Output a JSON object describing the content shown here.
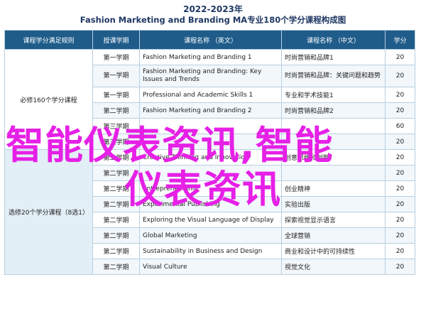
{
  "title": {
    "line1": "2022-2023年",
    "line2": "Fashion Marketing and Branding MA专业180个学分课程构成图"
  },
  "table": {
    "headers": [
      "课程学分满足规则",
      "授课学期",
      "课程名称 （英文）",
      "课程名称 （中文）",
      "学分"
    ],
    "groups": [
      {
        "label": "必修160个学分课程",
        "rows": [
          {
            "sem": "第一学期",
            "en": "Fashion Marketing and Branding 1",
            "zh": "时尚营销和品牌1",
            "cr": "20"
          },
          {
            "sem": "第一学期",
            "en": "Fashion Marketing and Branding: Key Issues and Trends",
            "zh": "时尚营销和品牌：关键问题和趋势",
            "cr": "20"
          },
          {
            "sem": "第一学期",
            "en": "Professional and Academic Skills 1",
            "zh": "专业和学术技能1",
            "cr": "20"
          },
          {
            "sem": "第二学期",
            "en": "Fashion Marketing and Branding 2",
            "zh": "时尚营销和品牌2",
            "cr": "20"
          },
          {
            "sem": "第三学期",
            "en": "",
            "zh": "",
            "cr": "60"
          },
          {
            "sem": "第三学期",
            "en": "",
            "zh": "",
            "cr": "20"
          }
        ]
      },
      {
        "label": "选修20个学分课程（8选1）",
        "rows": [
          {
            "sem": "第二学期",
            "en": "Creative Thinking and Innovation",
            "zh": "创意思维和创新",
            "cr": "20"
          },
          {
            "sem": "第二学期",
            "en": "",
            "zh": "",
            "cr": "20"
          },
          {
            "sem": "第二学期",
            "en": "Entrepreneurship",
            "zh": "创业精神",
            "cr": "20"
          },
          {
            "sem": "第二学期",
            "en": "Experimental Publishing",
            "zh": "实验出版",
            "cr": "20"
          },
          {
            "sem": "第二学期",
            "en": "Exploring the Visual Language of Display",
            "zh": "探索视觉显示语言",
            "cr": "20"
          },
          {
            "sem": "第二学期",
            "en": "Global Marketing",
            "zh": "全球营销",
            "cr": "20"
          },
          {
            "sem": "第二学期",
            "en": "Sustainability in Business and Design",
            "zh": "商业和设计中的可持续性",
            "cr": "20"
          },
          {
            "sem": "第二学期",
            "en": "Visual Culture",
            "zh": "视觉文化",
            "cr": "20"
          }
        ]
      }
    ]
  },
  "watermark": {
    "line1": "智能仪表资讯,智能",
    "line2": "仪表资讯",
    "color": "#e620e6"
  },
  "colors": {
    "header_bg": "#1f5c8a",
    "elective_bg": "#e3eff6",
    "title": "#1f3864"
  }
}
